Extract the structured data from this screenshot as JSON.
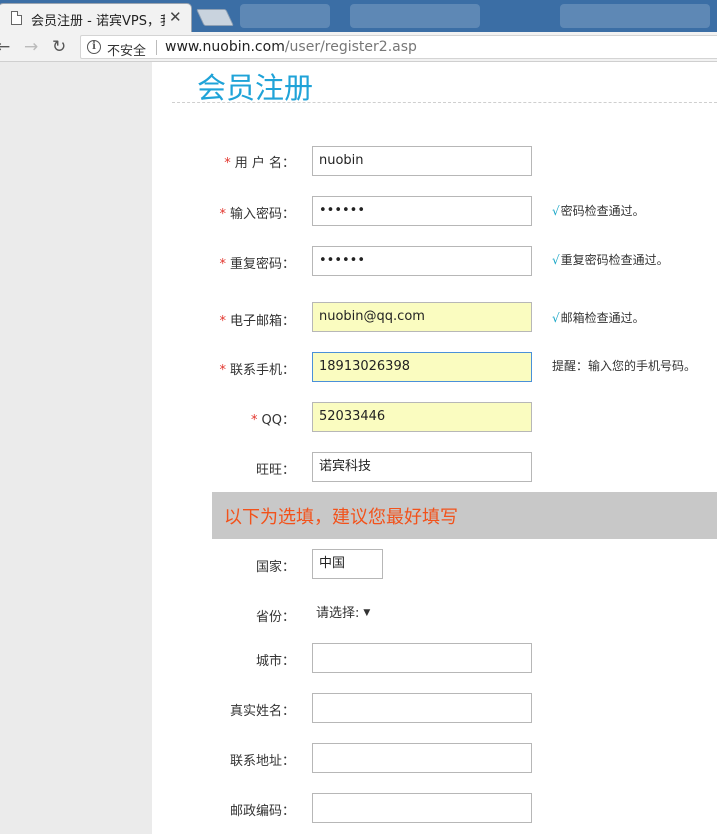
{
  "browser": {
    "tab_title": "会员注册 - 诺宾VPS，我",
    "tab_close": "✕",
    "security_label": "不安全",
    "url_host": "www.nuobin.com",
    "url_path": "/user/register2.asp"
  },
  "page": {
    "title": "会员注册",
    "optional_heading": "以下为选填，建议您最好填写"
  },
  "form": {
    "username": {
      "label": "用 户 名：",
      "value": "nuobin",
      "required": true
    },
    "password": {
      "label": "输入密码：",
      "value": "••••••",
      "required": true,
      "hint": "密码检查通过。"
    },
    "password_repeat": {
      "label": "重复密码：",
      "value": "••••••",
      "required": true,
      "hint": "重复密码检查通过。"
    },
    "email": {
      "label": "电子邮箱：",
      "value": "nuobin@qq.com",
      "required": true,
      "hint": "邮箱检查通过。"
    },
    "mobile": {
      "label": "联系手机：",
      "value": "18913026398",
      "required": true,
      "hint": "提醒：输入您的手机号码。"
    },
    "qq": {
      "label": "QQ：",
      "value": "52033446",
      "required": true
    },
    "wangwang": {
      "label": "旺旺：",
      "value": "诺宾科技"
    },
    "country": {
      "label": "国家：",
      "value": "中国"
    },
    "province": {
      "label": "省份：",
      "value": "请选择:"
    },
    "city": {
      "label": "城市：",
      "value": ""
    },
    "realname": {
      "label": "真实姓名：",
      "value": ""
    },
    "address": {
      "label": "联系地址：",
      "value": ""
    },
    "postcode": {
      "label": "邮政编码：",
      "value": ""
    }
  },
  "symbols": {
    "required_mark": "*",
    "check_mark": "√",
    "select_arrow": "▼"
  },
  "colors": {
    "title": "#1fa3d8",
    "required": "#e2332b",
    "optional_heading": "#f2521b",
    "autofill": "#fafcc0",
    "check": "#19a7c7"
  }
}
